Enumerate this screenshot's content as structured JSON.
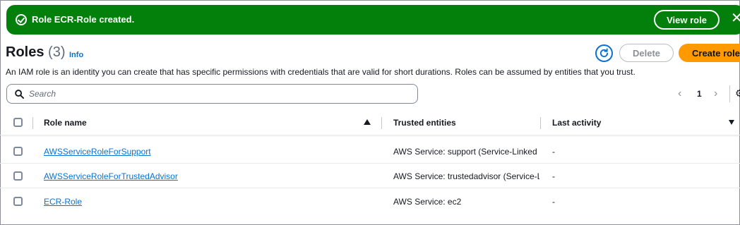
{
  "flash": {
    "message": "Role ECR-Role created.",
    "view_label": "View role",
    "close": "✕",
    "color": "#037f0c"
  },
  "header": {
    "title": "Roles",
    "count": "(3)",
    "info": "Info",
    "delete_label": "Delete",
    "create_label": "Create role",
    "description": "An IAM role is an identity you can create that has specific permissions with credentials that are valid for short durations. Roles can be assumed by entities that you trust."
  },
  "search": {
    "placeholder": "Search",
    "value": ""
  },
  "pagination": {
    "prev": "‹",
    "page": "1",
    "next": "›",
    "settings": "⚙"
  },
  "table": {
    "columns": {
      "role_name": "Role name",
      "trusted": "Trusted entities",
      "activity": "Last activity"
    },
    "rows": [
      {
        "name": "AWSServiceRoleForSupport",
        "trusted_prefix": "AWS Service: support (",
        "trusted_link": "Service-Linked",
        "activity": "-"
      },
      {
        "name": "AWSServiceRoleForTrustedAdvisor",
        "trusted_prefix": "AWS Service: trustedadvisor (",
        "trusted_link": "Service-Linked",
        "activity": "-"
      },
      {
        "name": "ECR-Role",
        "trusted_prefix": "AWS Service: ec2",
        "trusted_link": "",
        "activity": "-"
      }
    ]
  },
  "colors": {
    "accent": "#0972d3",
    "primary_button": "#ff9900"
  }
}
